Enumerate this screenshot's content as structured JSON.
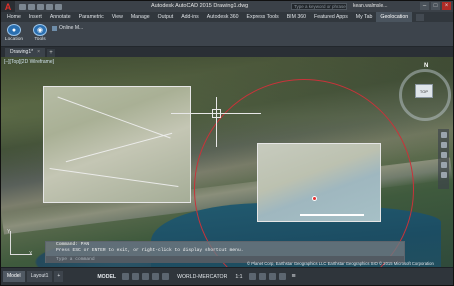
{
  "window": {
    "app_title": "Autodesk AutoCAD 2015   Drawing1.dwg",
    "search_placeholder": "Type a keyword or phrase",
    "user": "kean.walmsle...",
    "minimize": "–",
    "maximize": "□",
    "close": "×"
  },
  "app_logo": "A",
  "ribbon_tabs": [
    "Home",
    "Insert",
    "Annotate",
    "Parametric",
    "View",
    "Manage",
    "Output",
    "Add-ins",
    "Autodesk 360",
    "Express Tools",
    "BIM 360",
    "Featured Apps",
    "My Tab",
    "Geolocation"
  ],
  "active_tab": "Geolocation",
  "ribbon": {
    "location_label": "Location",
    "tools_label": "Tools",
    "online_label": "Online M..."
  },
  "doc_tab": {
    "name": "Drawing1*",
    "close": "×",
    "new": "+"
  },
  "viewport": {
    "label": "[–][Top][2D Wireframe]",
    "compass_n": "N",
    "viewcube_face": "TOP",
    "ucs_x": "X",
    "ucs_y": "Y"
  },
  "command_line": {
    "history": [
      "Command: PAN",
      "Press ESC or ENTER to exit, or right-click to display shortcut menu."
    ],
    "prompt": "Type a command"
  },
  "copyright": "© Planet Corp, Earthstar Geographics LLC Earthstar Geographics SIO © 2015 Microsoft Corporation",
  "status_bar": {
    "layout_tabs": [
      "Model",
      "Layout1",
      "+"
    ],
    "model": "MODEL",
    "coord_system": "WORLD-MERCATOR",
    "scale": "1:1",
    "menu": "≡"
  },
  "colors": {
    "accent": "#2a6fb0",
    "marker": "#e33030",
    "circle": "#c8333a"
  }
}
